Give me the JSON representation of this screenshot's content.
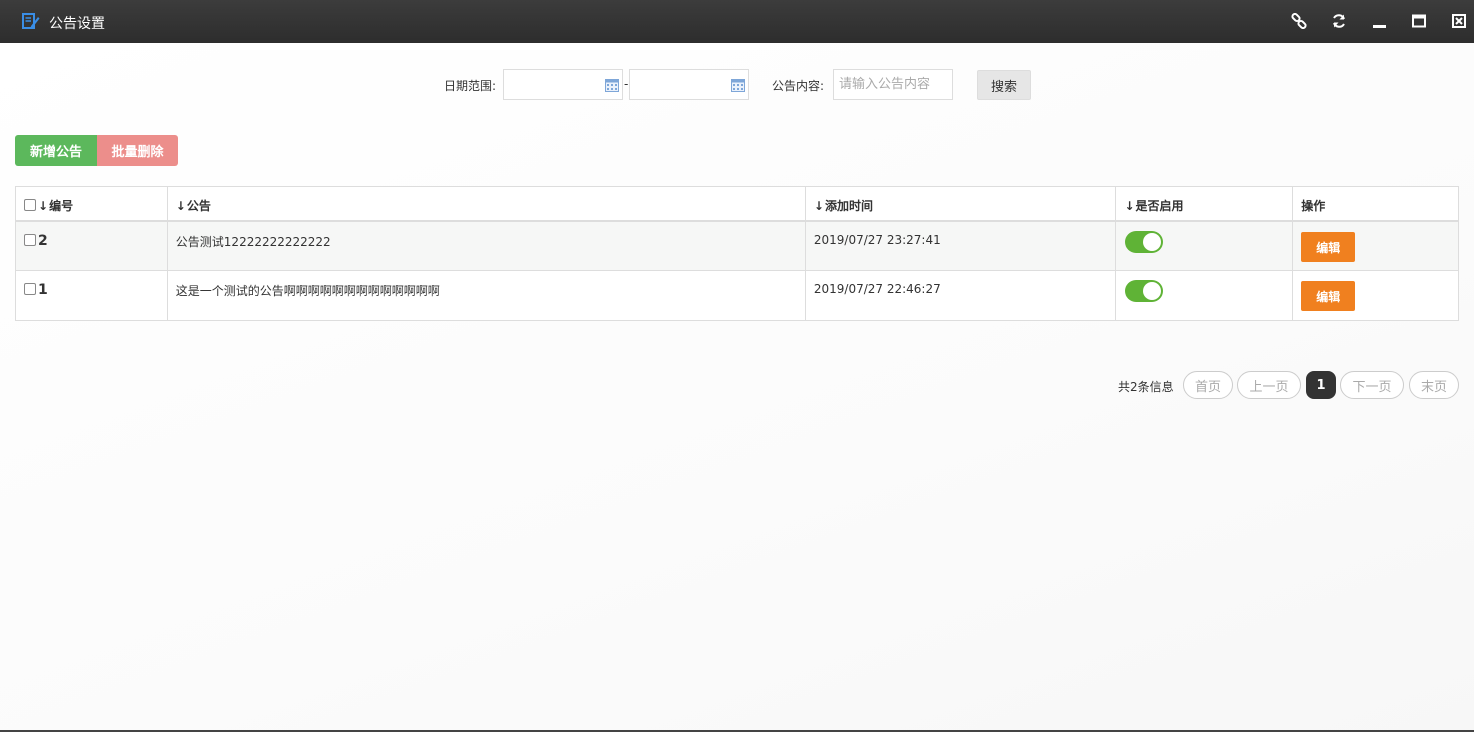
{
  "window": {
    "title": "公告设置",
    "icons": [
      "edit-icon",
      "link-icon",
      "refresh-icon",
      "minimize-icon",
      "maximize-icon",
      "close-icon"
    ]
  },
  "search": {
    "date_label": "日期范围:",
    "date_start": "",
    "date_end": "",
    "date_separator": "-",
    "content_label": "公告内容:",
    "content_placeholder": "请输入公告内容",
    "content_value": "",
    "button_label": "搜索"
  },
  "actions": {
    "add_label": "新增公告",
    "batch_delete_label": "批量删除"
  },
  "table": {
    "headers": {
      "id": "编号",
      "notice": "公告",
      "added_time": "添加时间",
      "enabled": "是否启用",
      "operation": "操作"
    },
    "rows": [
      {
        "id": "2",
        "notice": "公告测试12222222222222",
        "added_time": "2019/07/27 23:27:41",
        "enabled": true,
        "edit_label": "编辑"
      },
      {
        "id": "1",
        "notice": "这是一个测试的公告啊啊啊啊啊啊啊啊啊啊啊啊啊",
        "added_time": "2019/07/27 22:46:27",
        "enabled": true,
        "edit_label": "编辑"
      }
    ]
  },
  "pagination": {
    "total_text": "共2条信息",
    "first": "首页",
    "prev": "上一页",
    "current": "1",
    "next": "下一页",
    "last": "末页"
  },
  "colors": {
    "titlebar": "#2d2d2d",
    "add_button": "#5cb85c",
    "delete_button": "#ec8e8b",
    "toggle_on": "#5fb336",
    "edit_button": "#f0801f",
    "page_active": "#333333"
  }
}
